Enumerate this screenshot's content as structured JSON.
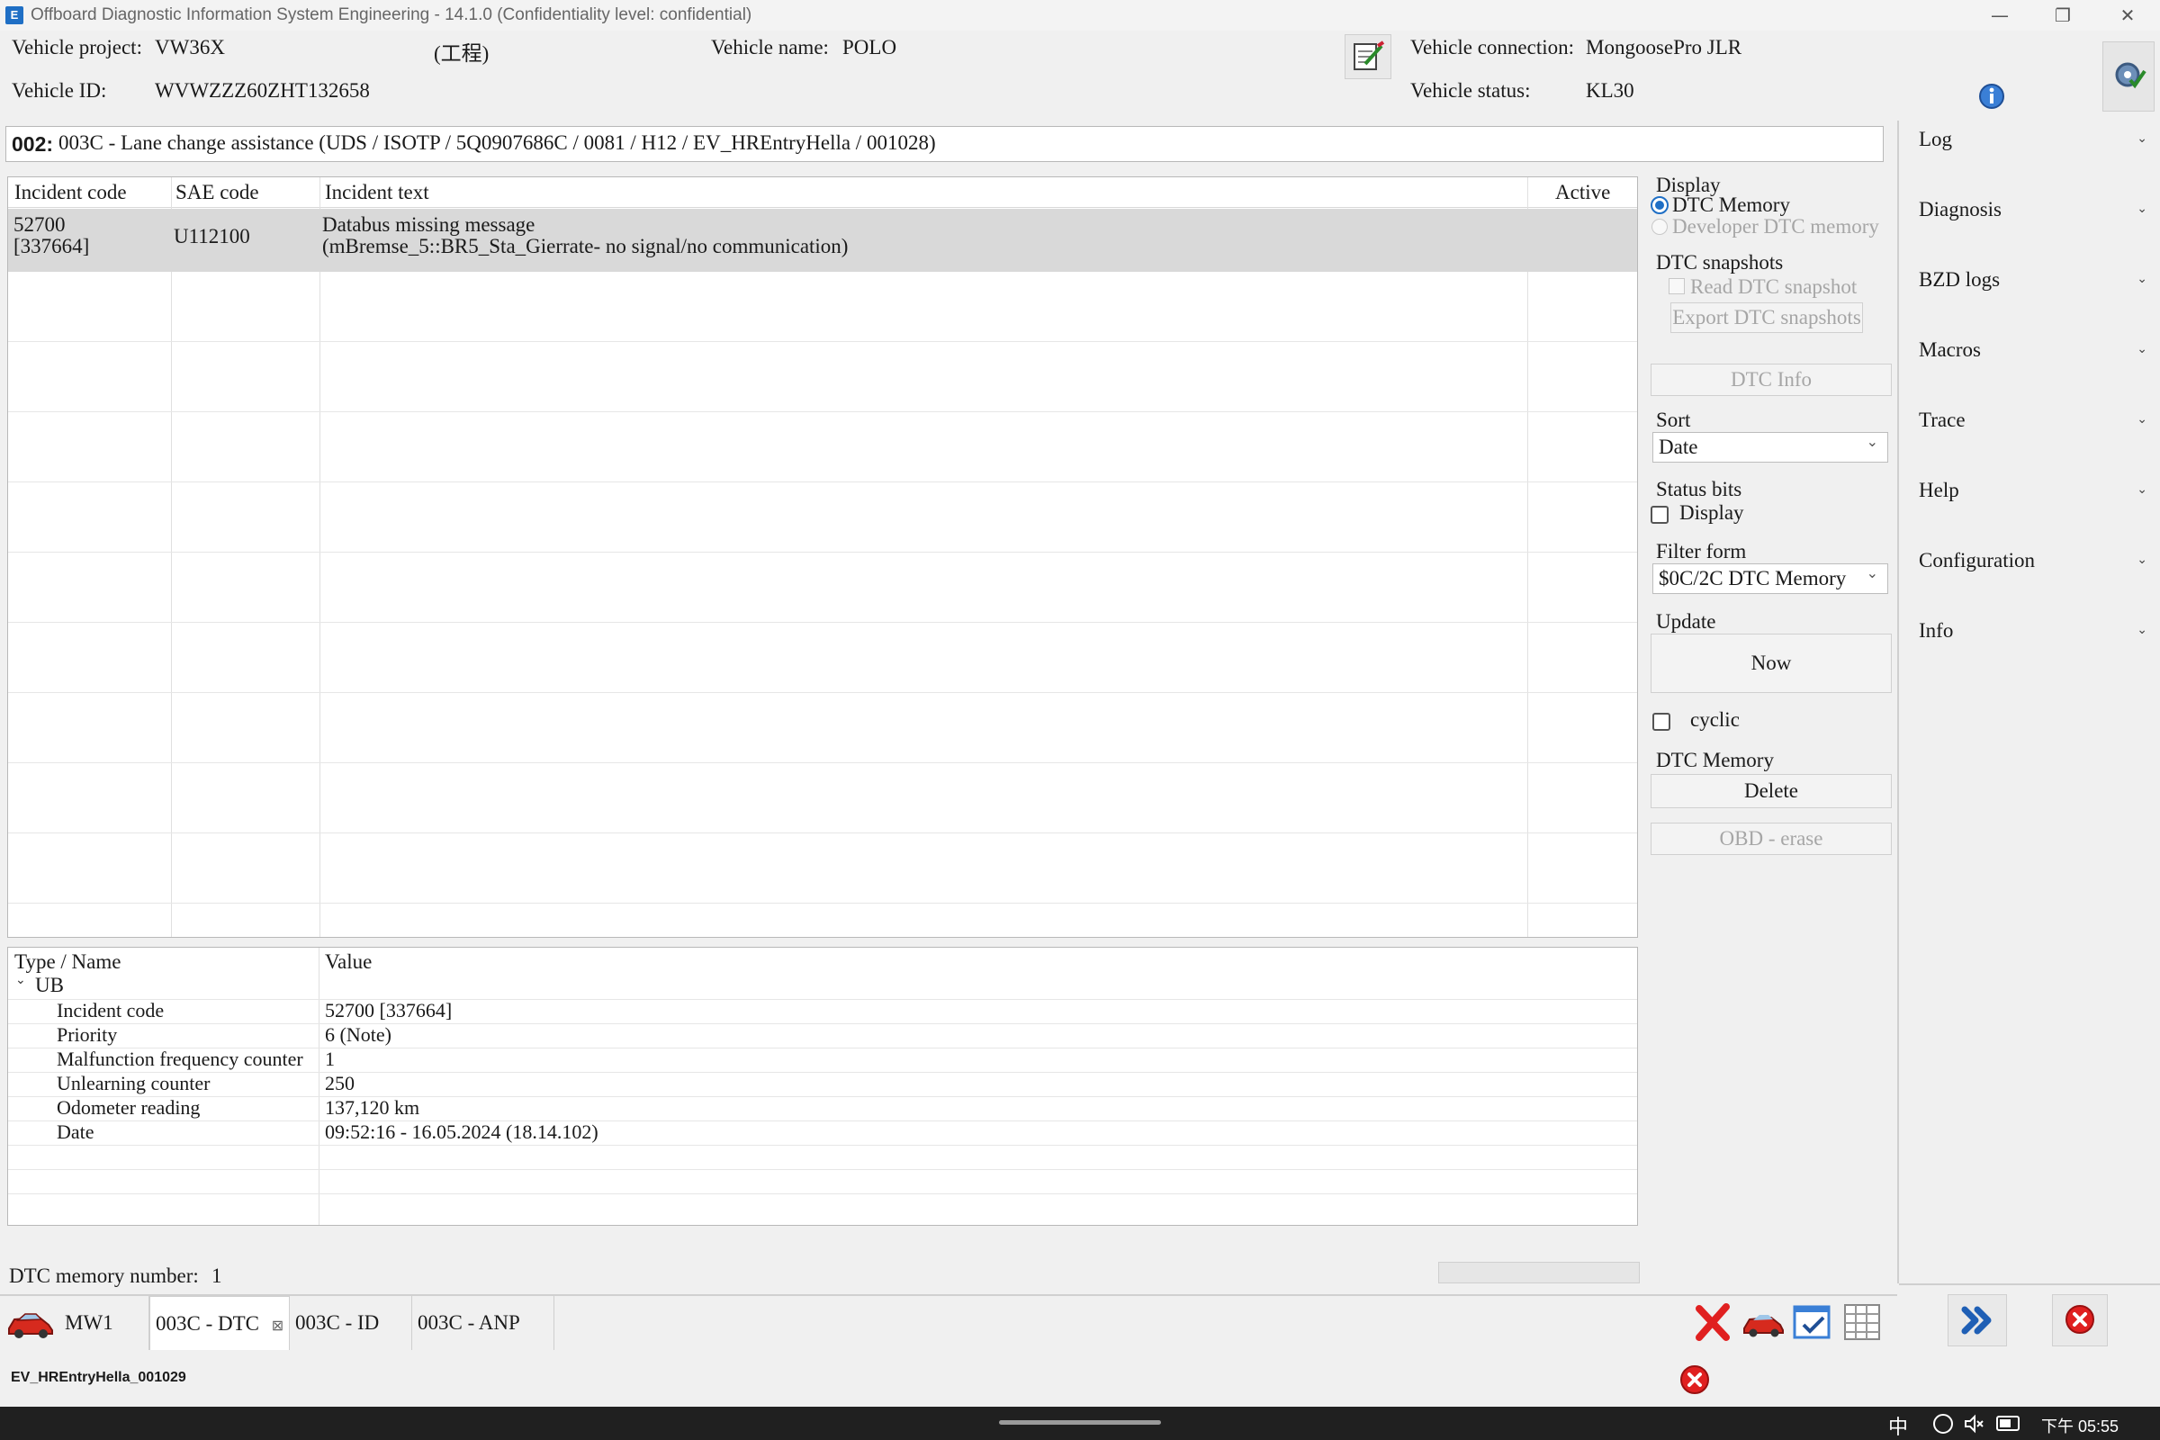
{
  "window": {
    "title": "Offboard Diagnostic Information System Engineering - 14.1.0 (Confidentiality level: confidential)",
    "minimize": "—",
    "restore": "❐",
    "close": "✕"
  },
  "header": {
    "project_label": "Vehicle project:",
    "project_value": "VW36X",
    "project_extra": "(工程)",
    "name_label": "Vehicle name:",
    "name_value": "POLO",
    "id_label": "Vehicle ID:",
    "id_value": "WVWZZZ60ZHT132658",
    "connection_label": "Vehicle connection:",
    "connection_value": "MongoosePro JLR",
    "status_label": "Vehicle status:",
    "status_value": "KL30"
  },
  "ecu": {
    "number": "002:",
    "description": "003C - Lane change assistance  (UDS / ISOTP / 5Q0907686C / 0081 / H12 / EV_HREntryHella / 001028)"
  },
  "dtc_table": {
    "columns": [
      "Incident code",
      "SAE code",
      "Incident text",
      "Active"
    ],
    "rows": [
      {
        "incident_code": "52700",
        "incident_code_sub": "[337664]",
        "sae_code": "U112100",
        "text_line1": "Databus missing message",
        "text_line2": "(mBremse_5::BR5_Sta_Gierrate- no signal/no communication)",
        "active": ""
      }
    ]
  },
  "detail_table": {
    "columns": [
      "Type / Name",
      "Value"
    ],
    "group": "UB",
    "rows": [
      {
        "name": "Incident code",
        "value": "52700 [337664]"
      },
      {
        "name": "Priority",
        "value": "6 (Note)"
      },
      {
        "name": "Malfunction frequency counter",
        "value": "1"
      },
      {
        "name": "Unlearning counter",
        "value": "250"
      },
      {
        "name": "Odometer reading",
        "value": "137,120 km"
      },
      {
        "name": "Date",
        "value": "09:52:16 - 16.05.2024  (18.14.102)"
      }
    ]
  },
  "dtc_memory_number": {
    "label": "DTC memory number:",
    "value": "1"
  },
  "controls": {
    "display_label": "Display",
    "display_opt1": "DTC Memory",
    "display_opt2": "Developer DTC memory",
    "snapshots_label": "DTC snapshots",
    "read_snapshot": "Read DTC snapshot",
    "export_snapshots": "Export DTC snapshots",
    "dtc_info": "DTC Info",
    "sort_label": "Sort",
    "sort_value": "Date",
    "status_bits_label": "Status bits",
    "status_bits_display": "Display",
    "filter_label": "Filter form",
    "filter_value": "$0C/2C DTC Memory",
    "update_label": "Update",
    "update_now": "Now",
    "cyclic": "cyclic",
    "memory_label": "DTC Memory",
    "delete": "Delete",
    "obd_erase": "OBD - erase"
  },
  "side_menu": [
    "Log",
    "Diagnosis",
    "BZD logs",
    "Macros",
    "Trace",
    "Help",
    "Configuration",
    "Info"
  ],
  "tabs": [
    {
      "label": "MW1"
    },
    {
      "label": "003C - DTC",
      "close": "⊠"
    },
    {
      "label": "003C - ID"
    },
    {
      "label": "003C - ANP"
    }
  ],
  "status_bar": {
    "text": "EV_HREntryHella_001029"
  },
  "taskbar": {
    "ime": "中",
    "clock": "下午 05:55"
  },
  "colors": {
    "accent": "#1f6fc5",
    "selected_row": "#d9d9d9",
    "error_red": "#e02020"
  }
}
